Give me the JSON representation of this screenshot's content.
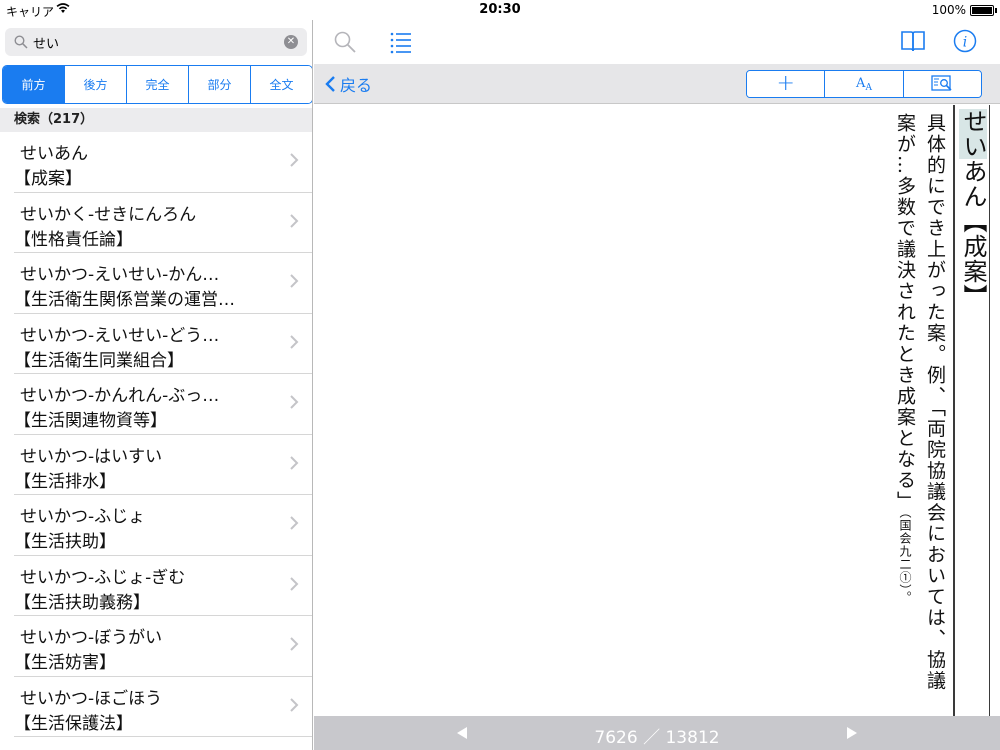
{
  "status": {
    "carrier": "キャリア",
    "time": "20:30",
    "battery": "100%"
  },
  "search": {
    "value": "せい",
    "placeholder": ""
  },
  "modes": [
    "前方",
    "後方",
    "完全",
    "部分",
    "全文"
  ],
  "active_mode": "前方",
  "results": {
    "header": "検索（217）",
    "items": [
      {
        "kana": "せいあん",
        "kanji": "【成案】"
      },
      {
        "kana": "せいかく-せきにんろん",
        "kanji": "【性格責任論】"
      },
      {
        "kana": "せいかつ-えいせい-かん…",
        "kanji": "【生活衛生関係営業の運営…"
      },
      {
        "kana": "せいかつ-えいせい-どう…",
        "kanji": "【生活衛生同業組合】"
      },
      {
        "kana": "せいかつ-かんれん-ぶっ…",
        "kanji": "【生活関連物資等】"
      },
      {
        "kana": "せいかつ-はいすい",
        "kanji": "【生活排水】"
      },
      {
        "kana": "せいかつ-ふじょ",
        "kanji": "【生活扶助】"
      },
      {
        "kana": "せいかつ-ふじょ-ぎむ",
        "kanji": "【生活扶助義務】"
      },
      {
        "kana": "せいかつ-ぼうがい",
        "kanji": "【生活妨害】"
      },
      {
        "kana": "せいかつ-ほごほう",
        "kanji": "【生活保護法】"
      }
    ]
  },
  "nav": {
    "back_label": "戻る",
    "tools": [
      "add-icon",
      "text-size-icon",
      "zoom-page-icon"
    ],
    "plus": "+",
    "aa_big": "A",
    "aa_small": "A"
  },
  "entry": {
    "kana": "せい",
    "kana_rest": "あん",
    "kanji": "【成案】",
    "col1": "具体的にでき上がった案。例、「両院協議会においては、協議",
    "col2": "案が…多数で議決されたとき成案となる」",
    "note": "（国会九二①）。"
  },
  "pager": {
    "text": "7626 ／ 13812"
  },
  "colors": {
    "accent": "#1a7cf0",
    "highlight": "#d8e6e6",
    "pager_bg": "#c8c8cc"
  }
}
